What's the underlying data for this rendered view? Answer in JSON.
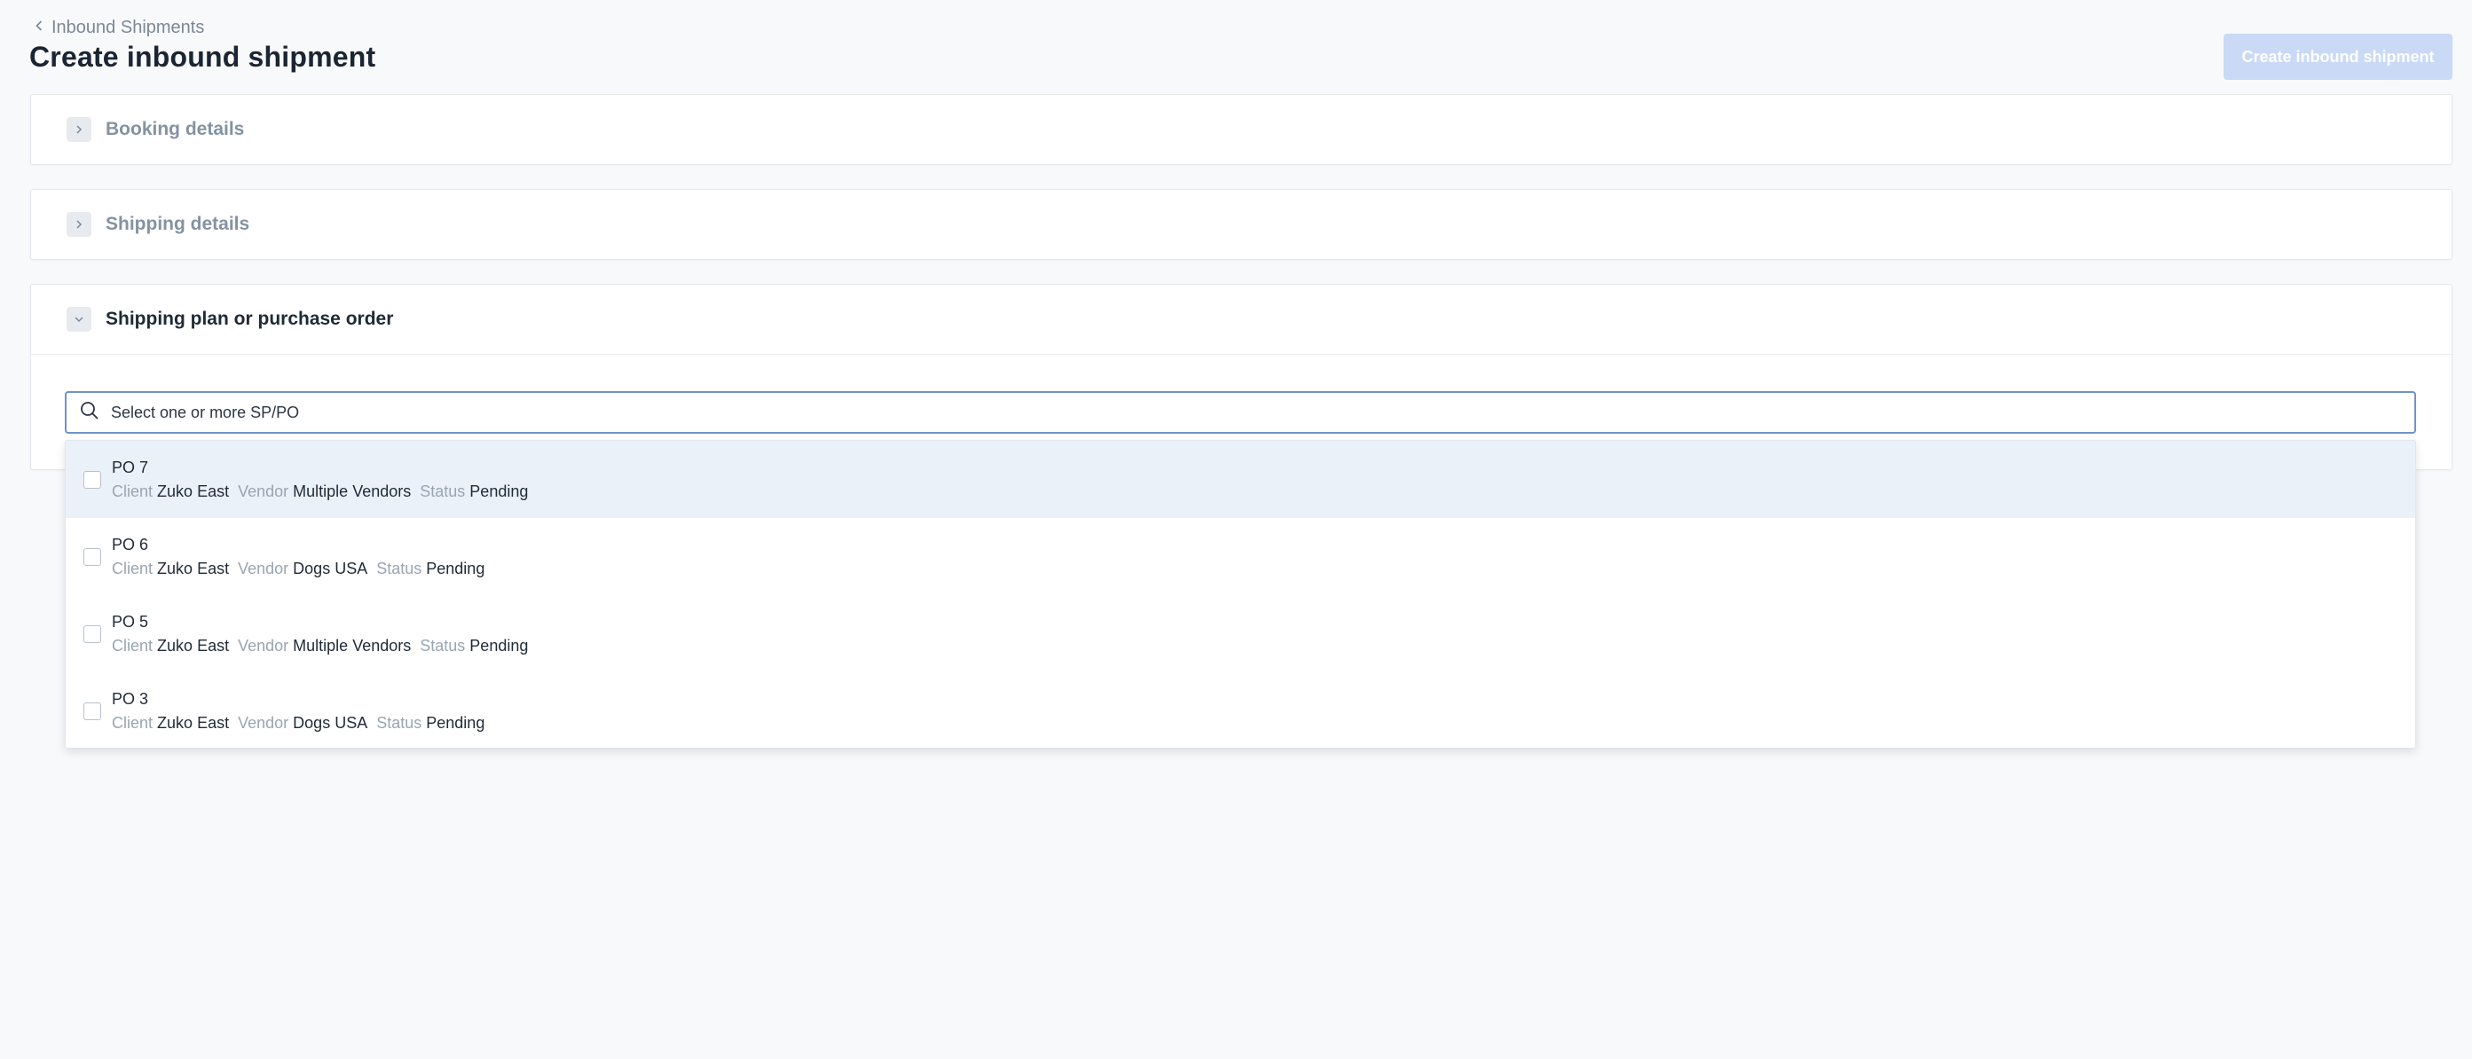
{
  "header": {
    "breadcrumb": "Inbound Shipments",
    "title": "Create inbound shipment",
    "create_button": "Create inbound shipment"
  },
  "sections": [
    {
      "title": "Booking details",
      "state": "collapsed"
    },
    {
      "title": "Shipping details",
      "state": "collapsed"
    },
    {
      "title": "Shipping plan or purchase order",
      "state": "expanded"
    }
  ],
  "search": {
    "placeholder": "Select one or more SP/PO",
    "value": ""
  },
  "labels": {
    "client": "Client",
    "vendor": "Vendor",
    "status": "Status"
  },
  "options": [
    {
      "name": "PO 7",
      "client": "Zuko East",
      "vendor": "Multiple Vendors",
      "status": "Pending",
      "checked": false
    },
    {
      "name": "PO 6",
      "client": "Zuko East",
      "vendor": "Dogs USA",
      "status": "Pending",
      "checked": false
    },
    {
      "name": "PO 5",
      "client": "Zuko East",
      "vendor": "Multiple Vendors",
      "status": "Pending",
      "checked": false
    },
    {
      "name": "PO 3",
      "client": "Zuko East",
      "vendor": "Dogs USA",
      "status": "Pending",
      "checked": false
    }
  ],
  "colors": {
    "primary_disabled": "#c9d9f6",
    "focus_border": "#6f93c9",
    "highlight_row": "#ebf1f9"
  },
  "icons": [
    "chevron-left-icon",
    "chevron-right-icon",
    "chevron-down-icon",
    "search-icon"
  ]
}
